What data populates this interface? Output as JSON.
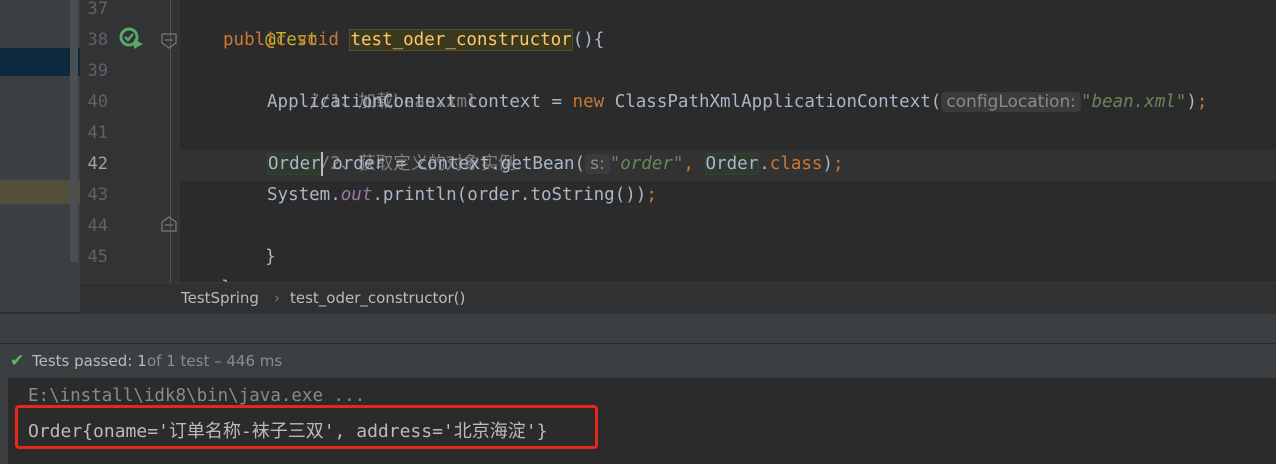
{
  "editor": {
    "line_numbers": [
      "37",
      "38",
      "39",
      "40",
      "41",
      "42",
      "43",
      "44",
      "45"
    ],
    "lines": {
      "l37": {
        "annotation": "@Test"
      },
      "l38": {
        "kw_public": "public",
        "kw_void": "void",
        "method": "test_oder_constructor",
        "tail": "(){"
      },
      "l39": {
        "comment": "//1、加载bean.xml"
      },
      "l40": {
        "lead": "ApplicationContext context = ",
        "kw_new": "new",
        "cls": " ClassPathXmlApplicationContext(",
        "hint": "configLocation:",
        "str": "\"bean.xml\"",
        "close": ")",
        "semi": ";"
      },
      "l41": {
        "comment": "//2、获取定义的对象实例"
      },
      "l42": {
        "type": "Order",
        "rest": " order = context.getBean(",
        "hint": "s:",
        "str": "\"order\"",
        "comma": ",",
        "type2": "Order",
        "dot": ".",
        "kw_class": "class",
        "close": ")",
        "semi": ";"
      },
      "l43": {
        "lead": "System.",
        "field": "out",
        "rest": ".println(order.toString())",
        "semi": ";"
      },
      "l44": {
        "brace": "}"
      },
      "l45": {
        "brace": "}"
      }
    }
  },
  "breadcrumb": {
    "items": [
      "TestSpring",
      "test_oder_constructor()"
    ],
    "separator": "›"
  },
  "test_status": {
    "label": "Tests passed:",
    "count": "1",
    "detail": "of 1 test – 446 ms"
  },
  "console": {
    "command": "E:\\install\\idk8\\bin\\java.exe ...",
    "output": "Order{oname='订单名称-袜子三双', address='北京海淀'}"
  },
  "colors": {
    "keyword": "#cc7832",
    "string": "#6a8759",
    "comment": "#808080",
    "annotation": "#bbb529",
    "highlight_box": "#e8261c",
    "pass_green": "#5fb85f"
  },
  "icons": {
    "run_test": "run-test-icon",
    "fold": "fold-icon",
    "passed": "check-icon"
  }
}
